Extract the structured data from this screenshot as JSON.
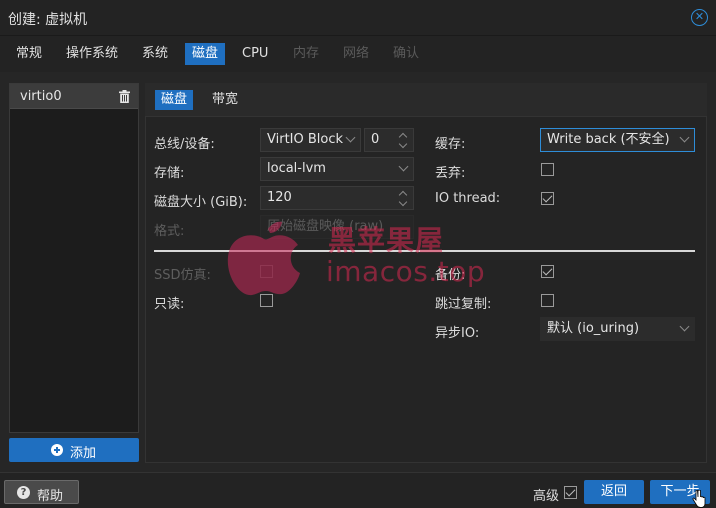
{
  "window": {
    "title": "创建: 虚拟机"
  },
  "tabs": [
    {
      "label": "常规",
      "state": "normal"
    },
    {
      "label": "操作系统",
      "state": "normal"
    },
    {
      "label": "系统",
      "state": "normal"
    },
    {
      "label": "磁盘",
      "state": "active"
    },
    {
      "label": "CPU",
      "state": "normal"
    },
    {
      "label": "内存",
      "state": "disabled"
    },
    {
      "label": "网络",
      "state": "disabled"
    },
    {
      "label": "确认",
      "state": "disabled"
    }
  ],
  "disks": {
    "items": [
      {
        "label": "virtio0"
      }
    ],
    "add_label": "添加"
  },
  "subtabs": [
    {
      "label": "磁盘",
      "state": "active"
    },
    {
      "label": "带宽",
      "state": "normal"
    }
  ],
  "form": {
    "bus_label": "总线/设备:",
    "bus_value": "VirtIO Block",
    "device_index": "0",
    "storage_label": "存储:",
    "storage_value": "local-lvm",
    "size_label": "磁盘大小 (GiB):",
    "size_value": "120",
    "format_label": "格式:",
    "format_value": "原始磁盘映像 (raw)",
    "cache_label": "缓存:",
    "cache_value": "Write back (不安全)",
    "discard_label": "丢弃:",
    "discard_checked": false,
    "iothread_label": "IO thread:",
    "iothread_checked": true,
    "ssd_label": "SSD仿真:",
    "ssd_checked": false,
    "readonly_label": "只读:",
    "readonly_checked": false,
    "backup_label": "备份:",
    "backup_checked": true,
    "skip_replication_label": "跳过复制:",
    "skip_replication_checked": false,
    "async_io_label": "异步IO:",
    "async_io_value": "默认 (io_uring)"
  },
  "watermark": {
    "line1": "黑苹果屋",
    "line2": "imacos.top"
  },
  "footer": {
    "help_label": "帮助",
    "advanced_label": "高级",
    "advanced_checked": true,
    "back_label": "返回",
    "next_label": "下一步"
  },
  "colors": {
    "accent": "#1f6fc0",
    "background": "#262626",
    "watermark": "#d72850"
  }
}
